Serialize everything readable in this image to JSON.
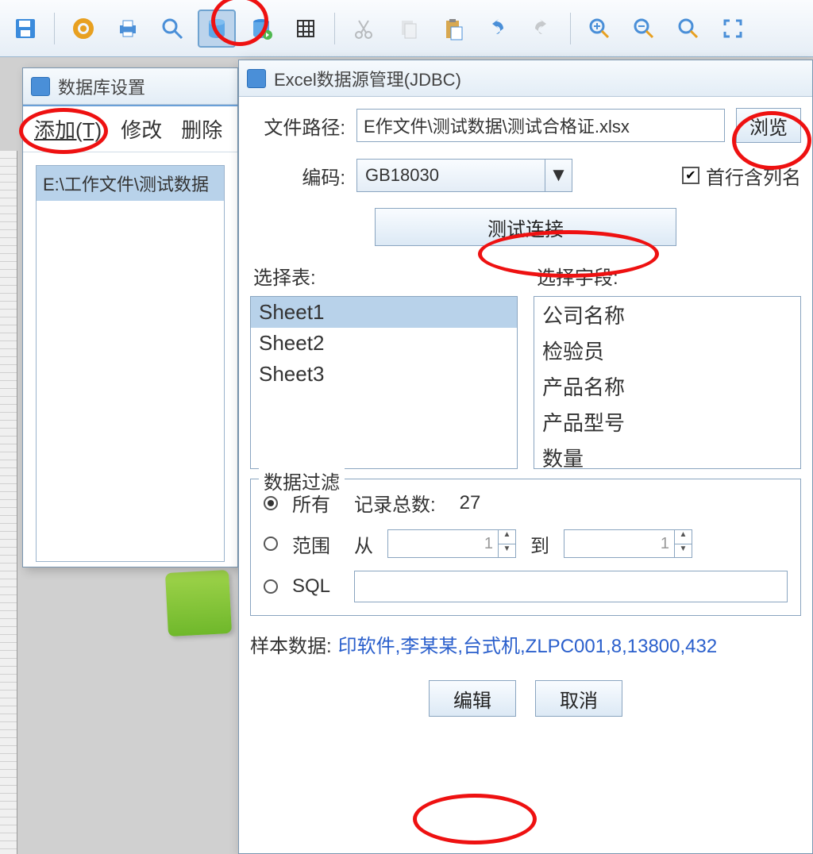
{
  "toolbar": {
    "icons": [
      "save",
      "gear",
      "print",
      "search",
      "db",
      "db-refresh",
      "grid",
      "cut",
      "copy",
      "paste",
      "undo",
      "redo",
      "zoom-in",
      "zoom-out",
      "fit",
      "fullscreen"
    ]
  },
  "dlg1": {
    "title": "数据库设置",
    "actions": {
      "add": "添加(T)",
      "modify": "修改",
      "delete": "删除"
    },
    "listItem": "E:\\工作文件\\测试数据"
  },
  "dlg2": {
    "title": "Excel数据源管理(JDBC)",
    "path_label": "文件路径:",
    "path_value": "E作文件\\测试数据\\测试合格证.xlsx",
    "browse": "浏览",
    "encoding_label": "编码:",
    "encoding_value": "GB18030",
    "first_row_header": "首行含列名",
    "test_connection": "测试连接",
    "select_table_label": "选择表:",
    "select_field_label": "选择字段:",
    "tables": [
      "Sheet1",
      "Sheet2",
      "Sheet3"
    ],
    "fields": [
      "公司名称",
      "检验员",
      "产品名称",
      "产品型号",
      "数量"
    ],
    "filter_legend": "数据过滤",
    "radio_all": "所有",
    "record_total_label": "记录总数:",
    "record_total": "27",
    "radio_range": "范围",
    "from_label": "从",
    "to_label": "到",
    "from_value": "1",
    "to_value": "1",
    "radio_sql": "SQL",
    "sample_label": "样本数据:",
    "sample_value": "印软件,李某某,台式机,ZLPC001,8,13800,432",
    "edit_btn": "编辑",
    "cancel_btn": "取消"
  }
}
